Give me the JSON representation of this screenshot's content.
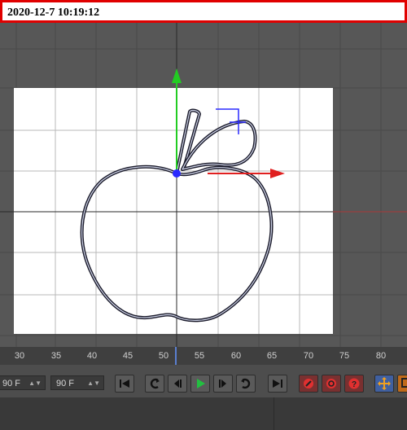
{
  "timestamp": "2020-12-7  10:19:12",
  "timeline": {
    "ticks": [
      "30",
      "35",
      "40",
      "45",
      "50",
      "55",
      "60",
      "65",
      "70",
      "75",
      "80"
    ]
  },
  "controls": {
    "start_frame": "90 F",
    "end_frame": "90 F"
  },
  "colors": {
    "timestamp_border": "#e00000",
    "axis_y": "#22cc22",
    "axis_x": "#e02020",
    "selection": "#2a2aff"
  }
}
